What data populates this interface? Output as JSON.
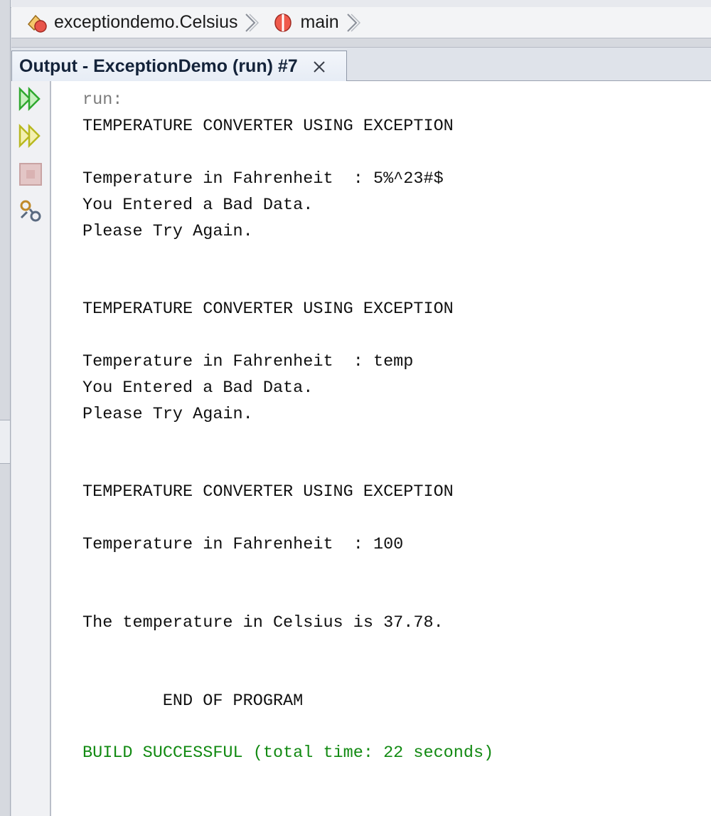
{
  "breadcrumb": {
    "class_label": "exceptiondemo.Celsius",
    "method_label": "main",
    "icons": [
      "class-icon",
      "method-icon",
      "chevron-right-icon"
    ]
  },
  "output_tab": {
    "title": "Output - ExceptionDemo (run) #7",
    "close_icon": "close-icon"
  },
  "gutter": {
    "icons": [
      "rerun-icon",
      "rerun-with-options-icon",
      "stop-icon",
      "settings-icon"
    ]
  },
  "console": {
    "lines": [
      "run:",
      "TEMPERATURE CONVERTER USING EXCEPTION",
      "Temperature in Fahrenheit  : 5%^23#$",
      "You Entered a Bad Data.",
      "Please Try Again.",
      "TEMPERATURE CONVERTER USING EXCEPTION",
      "Temperature in Fahrenheit  : temp",
      "You Entered a Bad Data.",
      "Please Try Again.",
      "TEMPERATURE CONVERTER USING EXCEPTION",
      "Temperature in Fahrenheit  : 100",
      "The temperature in Celsius is 37.78.",
      "        END OF PROGRAM",
      "BUILD SUCCESSFUL (total time: 22 seconds)"
    ]
  },
  "colors": {
    "build_success": "#128a12",
    "run_label": "#7b7b7b",
    "rerun_green": "#2fa82f",
    "rerun_yellow": "#b8b820"
  }
}
